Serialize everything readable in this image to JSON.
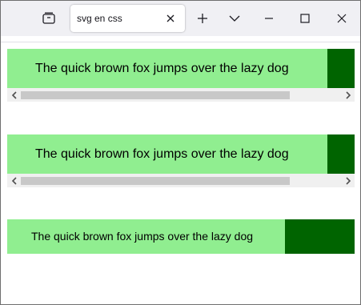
{
  "tab": {
    "title": "svg en css"
  },
  "banners": [
    {
      "text": "The quick brown fox jumps over the lazy dog"
    },
    {
      "text": "The quick brown fox jumps over the lazy dog"
    },
    {
      "text": "The quick brown fox jumps over the lazy dog"
    }
  ],
  "colors": {
    "banner_light": "#90ee90",
    "banner_dark": "#006400",
    "scroll_thumb": "#c8c8c8"
  },
  "icons": {
    "tab_list": "list-all-tabs-icon",
    "tab_close": "close-icon",
    "new_tab": "plus-icon",
    "tab_overflow": "chevron-down-icon",
    "minimize": "minimize-icon",
    "maximize": "maximize-icon",
    "close": "window-close-icon"
  }
}
